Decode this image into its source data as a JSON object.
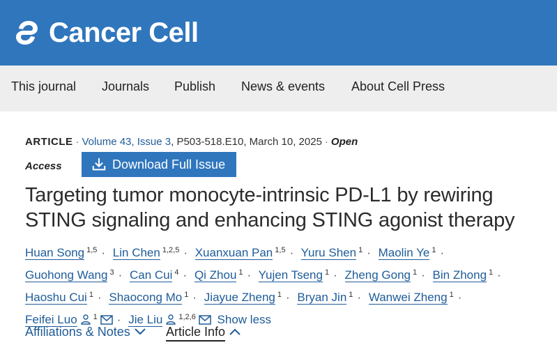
{
  "header": {
    "logo_text": "Cancer Cell"
  },
  "nav": {
    "items": [
      "This journal",
      "Journals",
      "Publish",
      "News & events",
      "About Cell Press"
    ]
  },
  "article": {
    "type": "ARTICLE",
    "volume_issue": "Volume 43, Issue 3",
    "pages": "P503-518.E10, March 10, 2025",
    "open_1": "Open",
    "open_2": "Access",
    "download_label": "Download Full Issue",
    "title": "Targeting tumor monocyte-intrinsic PD-L1 by rewiring STING signaling and enhancing STING agonist therapy"
  },
  "authors": [
    {
      "name": "Huan Song",
      "sup": "1,5"
    },
    {
      "name": "Lin Chen",
      "sup": "1,2,5"
    },
    {
      "name": "Xuanxuan Pan",
      "sup": "1,5"
    },
    {
      "name": "Yuru Shen",
      "sup": "1"
    },
    {
      "name": "Maolin Ye",
      "sup": "1"
    },
    {
      "name": "Guohong Wang",
      "sup": "3"
    },
    {
      "name": "Can Cui",
      "sup": "4"
    },
    {
      "name": "Qi Zhou",
      "sup": "1"
    },
    {
      "name": "Yujen Tseng",
      "sup": "1"
    },
    {
      "name": "Zheng Gong",
      "sup": "1"
    },
    {
      "name": "Bin Zhong",
      "sup": "1"
    },
    {
      "name": "Haoshu Cui",
      "sup": "1"
    },
    {
      "name": "Shaocong Mo",
      "sup": "1"
    },
    {
      "name": "Jiayue Zheng",
      "sup": "1"
    },
    {
      "name": "Bryan Jin",
      "sup": "1"
    },
    {
      "name": "Wanwei Zheng",
      "sup": "1"
    },
    {
      "name": "Feifei Luo",
      "sup": "1"
    },
    {
      "name": "Jie Liu",
      "sup": "1,2,6"
    }
  ],
  "show_less": "Show less",
  "tabs": {
    "affiliations": "Affiliations & Notes",
    "article_info": "Article Info"
  }
}
